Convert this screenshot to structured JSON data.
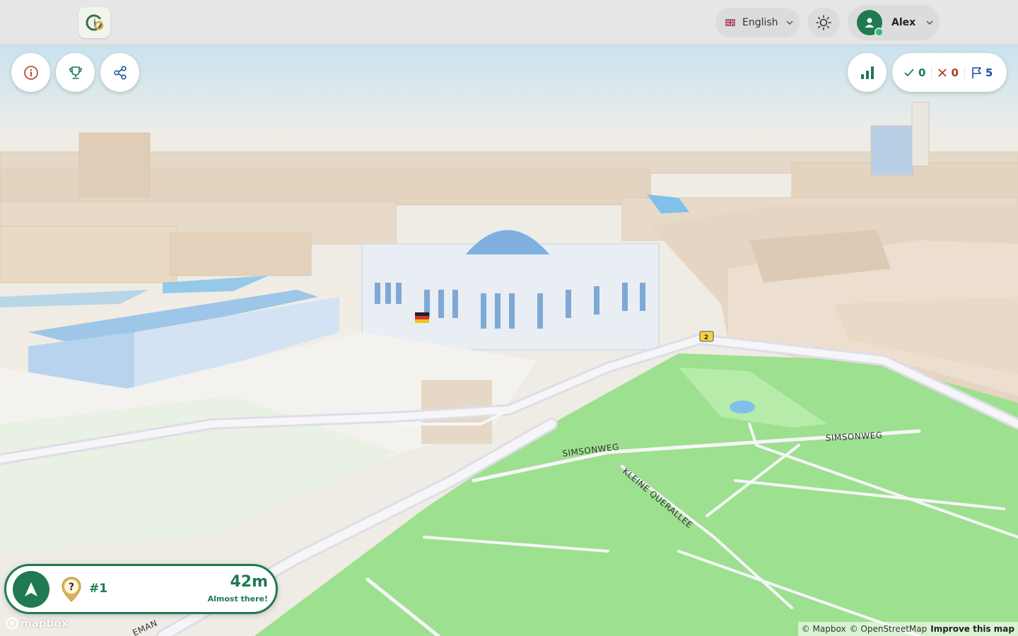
{
  "app": {
    "logo_icon": "globe-compass-logo-icon"
  },
  "header": {
    "language": {
      "label": "English",
      "flag_icon": "uk-flag-icon"
    },
    "theme_icon": "sun-icon",
    "user": {
      "name": "Alex",
      "status": "online"
    }
  },
  "toolbar": {
    "left_buttons": [
      "info-icon",
      "trophy-icon",
      "share-icon"
    ],
    "leaderboard_icon": "bar-chart-icon"
  },
  "stats": {
    "correct": "0",
    "wrong": "0",
    "flags": "5"
  },
  "map": {
    "road_labels": [
      "SIMSONWEG",
      "SIMSONWEG",
      "KLEINE QUERALLEE",
      "2",
      "EMAN"
    ],
    "colors": {
      "park": "#9de08f",
      "park_light": "#b6ebaa",
      "buildings": "#e6d8c6",
      "roads": "#f6f6f8",
      "water": "#7fc1ea",
      "sky": "#cfe4ef"
    }
  },
  "target": {
    "number": "#1",
    "distance": "42m",
    "proximity": "Almost there!"
  },
  "attribution": {
    "logo": "mapbox",
    "mapbox": "© Mapbox",
    "osm": "© OpenStreetMap",
    "improve": "Improve this map"
  },
  "theme": {
    "accent": "#1f7a52",
    "wrong": "#b43a1f",
    "flag": "#1b4f99"
  }
}
